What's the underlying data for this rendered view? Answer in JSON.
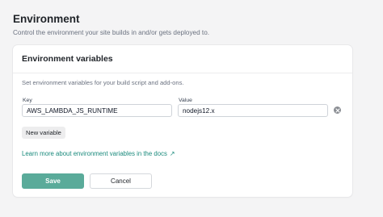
{
  "section": {
    "title": "Environment",
    "description": "Control the environment your site builds in and/or gets deployed to."
  },
  "card": {
    "title": "Environment variables",
    "description": "Set environment variables for your build script and add-ons."
  },
  "variables": [
    {
      "key_label": "Key",
      "key_value": "AWS_LAMBDA_JS_RUNTIME",
      "value_label": "Value",
      "value_value": "nodejs12.x"
    }
  ],
  "actions": {
    "new_variable_label": "New variable",
    "docs_link_label": "Learn more about environment variables in the docs",
    "docs_link_icon": "external-arrow-icon",
    "save_label": "Save",
    "cancel_label": "Cancel"
  },
  "colors": {
    "accent": "#1a8a7c",
    "save_button": "#5aab9a",
    "remove_icon": "#8a8d93"
  }
}
